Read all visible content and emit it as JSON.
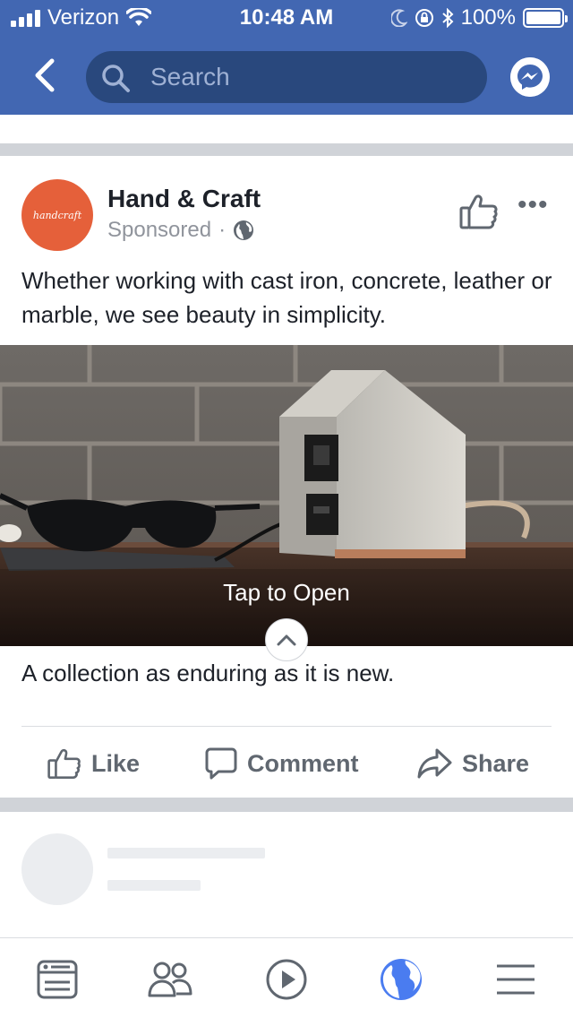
{
  "status_bar": {
    "carrier": "Verizon",
    "time": "10:48 AM",
    "battery": "100%"
  },
  "nav": {
    "search_placeholder": "Search"
  },
  "post": {
    "page_name": "Hand & Craft",
    "avatar_text": "handcraft",
    "sponsored_label": "Sponsored",
    "sponsored_separator": "·",
    "body": "Whether working with cast iron, concrete, leather or marble, we see beauty in simplicity.",
    "photo_cta": "Tap to Open",
    "caption": "A collection as enduring as it is new."
  },
  "actions": {
    "like": "Like",
    "comment": "Comment",
    "share": "Share"
  },
  "tabs": [
    "news-feed",
    "friends",
    "watch",
    "notifications",
    "menu"
  ],
  "colors": {
    "brand_blue": "#4267b2",
    "search_bg": "#29487d",
    "avatar_orange": "#e5603a",
    "active_tab": "#4a7cf0",
    "secondary_text": "#90949c"
  }
}
